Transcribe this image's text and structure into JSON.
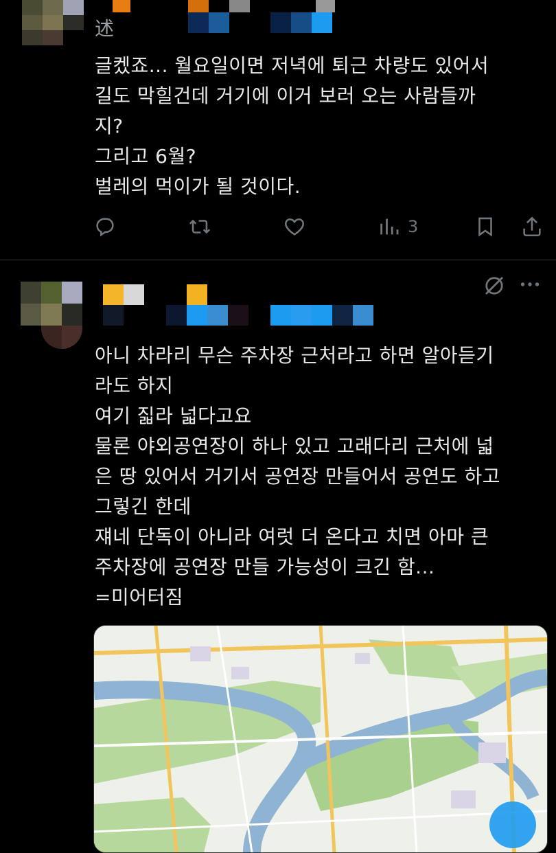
{
  "tweet1": {
    "lines": [
      "글켔죠... 월요일이면 저녁에 퇴근 차량도 있어서",
      "길도 막힐건데 거기에 이거 보러 오는 사람들까",
      "지?",
      "그리고 6월?",
      "벌레의 먹이가 될 것이다."
    ],
    "views_count": "3",
    "partial_name": "述"
  },
  "tweet2": {
    "lines": [
      "아니 차라리 무슨 주차장 근처라고 하면 알아듣기",
      "라도 하지",
      "여기 짋라 넓다고요",
      "물론 야외공연장이 하나 있고 고래다리 근처에 넓",
      "은 땅 있어서 거기서 공연장 만들어서 공연도 하고",
      "그렇긴 한데",
      "쟤네 단독이 아니라 여럿 더 온다고 치면 아마 큰",
      "주차장에 공연장 만들 가능성이 크긴 함...",
      "=미어터짐"
    ]
  },
  "icons": {
    "reply": "reply-icon",
    "retweet": "retweet-icon",
    "like": "like-icon",
    "views": "views-icon",
    "bookmark": "bookmark-icon",
    "share": "share-icon",
    "grok": "grok-icon",
    "more": "more-icon"
  },
  "colors": {
    "background": "#000000",
    "text": "#e7e9ea",
    "muted": "#71767b",
    "divider": "#2f3336",
    "river": "#7fa7c9",
    "park": "#a9d08e",
    "road": "#f2c55c"
  }
}
